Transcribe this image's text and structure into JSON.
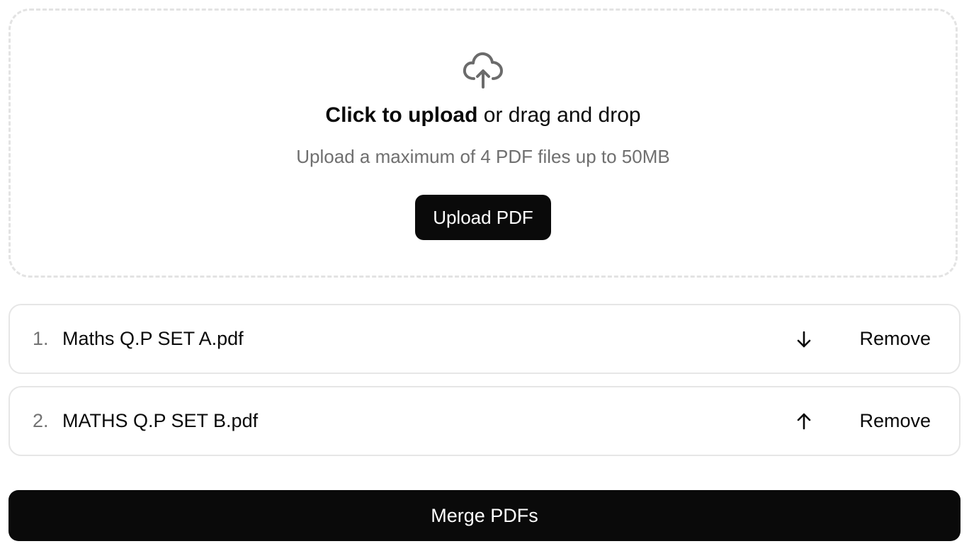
{
  "dropzone": {
    "icon": "cloud-upload-icon",
    "headline_strong": "Click to upload",
    "headline_rest": " or drag and drop",
    "subtext": "Upload a maximum of 4 PDF files up to 50MB",
    "upload_label": "Upload PDF"
  },
  "files": [
    {
      "index": "1.",
      "name": "Maths Q.P SET A.pdf",
      "move_icon": "arrow-down-icon",
      "remove_label": "Remove"
    },
    {
      "index": "2.",
      "name": "MATHS Q.P SET B.pdf",
      "move_icon": "arrow-up-icon",
      "remove_label": "Remove"
    }
  ],
  "merge": {
    "label": "Merge PDFs"
  },
  "colors": {
    "primary": "#0a0a0a",
    "muted_text": "#6f6f6f",
    "border": "#e6e6e6",
    "dashed_border": "#e3e3e3",
    "icon_gray": "#6b6b6b"
  }
}
